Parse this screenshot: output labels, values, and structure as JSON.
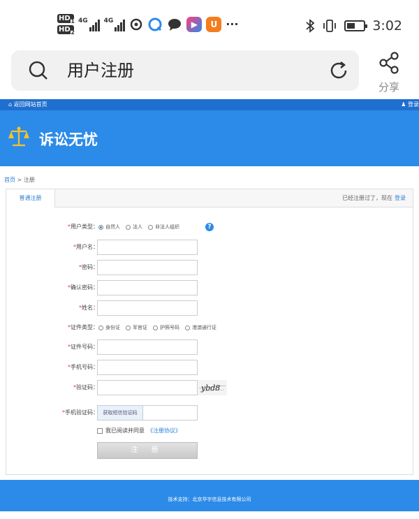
{
  "status_bar": {
    "hd1": "HD",
    "hd1_sub": "1",
    "hd2": "HD",
    "hd2_sub": "2",
    "signal1": "4G",
    "signal2": "4G",
    "more": "···",
    "time": "3:02",
    "icons": [
      "hd-icon",
      "signal-icon",
      "app-icon",
      "bluetooth-icon",
      "vibrate-icon",
      "battery-icon"
    ]
  },
  "browser": {
    "address_title": "用户注册",
    "share_label": "分享"
  },
  "site": {
    "home_link": "返回网站首页",
    "login_link": "登录",
    "brand": "诉讼无忧",
    "accent_color": "#2c8be8"
  },
  "breadcrumb": {
    "home": "首页",
    "sep": " > ",
    "current": "注册"
  },
  "tabs": {
    "active": "普通注册",
    "already_registered": "已经注册过了，现在",
    "login": "登录"
  },
  "form": {
    "user_type": {
      "label": "用户类型：",
      "options": [
        "自然人",
        "法人",
        "非法人组织"
      ],
      "selected": "自然人"
    },
    "username_label": "用户名：",
    "password_label": "密码：",
    "confirm_password_label": "确认密码：",
    "name_label": "姓名：",
    "id_type": {
      "label": "证件类型：",
      "options": [
        "身份证",
        "军官证",
        "护照号码",
        "港澳通行证"
      ],
      "selected": ""
    },
    "id_number_label": "证件号码：",
    "phone_label": "手机号码：",
    "captcha_label": "验证码：",
    "captcha_text": "ybd8",
    "sms_label": "手机验证码：",
    "sms_button": "获取短信验证码",
    "agree_text": "我已阅读并同意",
    "agreement_link": "《注册协议》",
    "submit": "注 册"
  },
  "footer": {
    "text": "技术支持：北京华宇信息技术有限公司"
  }
}
